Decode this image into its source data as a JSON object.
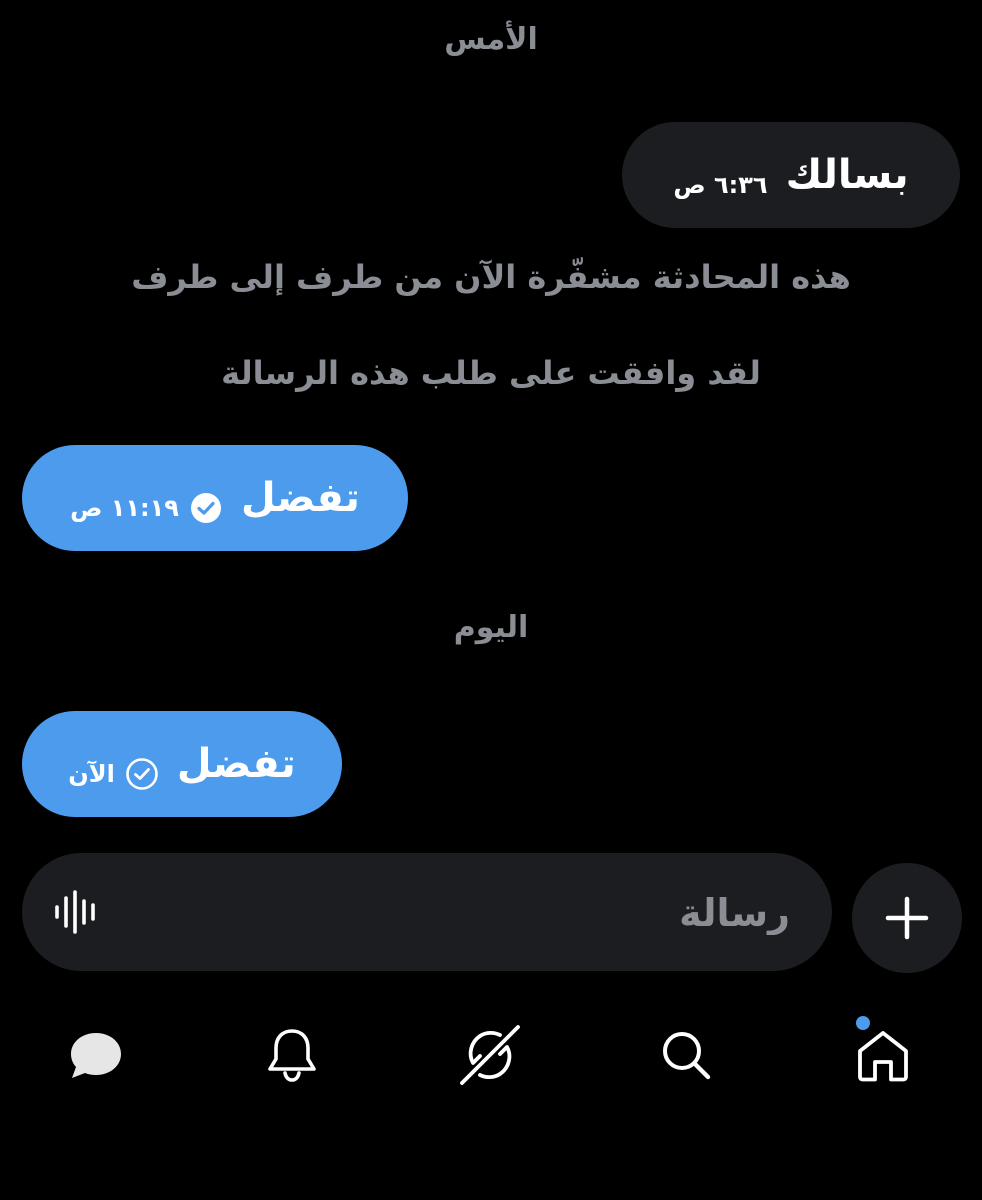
{
  "conversation": {
    "yesterday_label": "الأمس",
    "today_label": "اليوم",
    "notice_encrypted": "هذه المحادثة مشفّرة الآن من طرف إلى طرف",
    "notice_accepted": "لقد وافقت على طلب هذه الرسالة",
    "messages": [
      {
        "text": "بسالك",
        "time": "٦:٣٦ ص",
        "direction": "incoming"
      },
      {
        "text": "تفضل",
        "time": "١١:١٩ ص",
        "direction": "outgoing",
        "status": "read-check-icon"
      },
      {
        "text": "تفضل",
        "time": "الآن",
        "direction": "outgoing",
        "status": "sent-check-icon"
      }
    ]
  },
  "composer": {
    "placeholder": "رسالة",
    "voice_icon": "voice-waveform-icon",
    "plus_icon": "plus-icon"
  },
  "nav": {
    "items": [
      "messages-icon",
      "notifications-icon",
      "grok-icon",
      "search-icon",
      "home-icon"
    ],
    "home_badge": "dot"
  },
  "colors": {
    "background": "#000000",
    "incoming_bubble": "#1c1d20",
    "outgoing_bubble": "#4c9bec",
    "muted_text": "#8a8d93",
    "accent": "#4c9bec"
  }
}
